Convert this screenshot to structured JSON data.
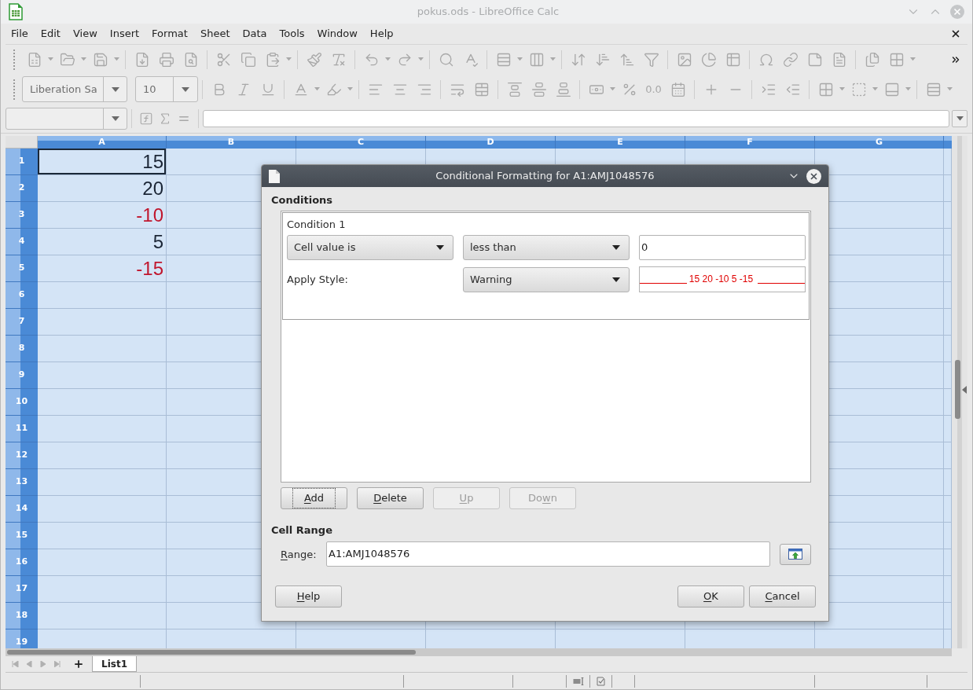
{
  "window": {
    "title": "pokus.ods - LibreOffice Calc"
  },
  "menu_bar": {
    "items": [
      "File",
      "Edit",
      "View",
      "Insert",
      "Format",
      "Sheet",
      "Data",
      "Tools",
      "Window",
      "Help"
    ]
  },
  "toolbars": {
    "disabled": true,
    "font_name": "Liberation Sa",
    "font_size": "10",
    "number_format": "0.0"
  },
  "sheet": {
    "selected": true,
    "columns": [
      "A",
      "B",
      "C",
      "D",
      "E",
      "F",
      "G"
    ],
    "rows": [
      {
        "number": "1",
        "value": "15",
        "warning": false,
        "active": true
      },
      {
        "number": "2",
        "value": "20",
        "warning": false,
        "active": false
      },
      {
        "number": "3",
        "value": "-10",
        "warning": true,
        "active": false
      },
      {
        "number": "4",
        "value": "5",
        "warning": false,
        "active": false
      },
      {
        "number": "5",
        "value": "-15",
        "warning": true,
        "active": false
      },
      {
        "number": "6"
      },
      {
        "number": "7"
      },
      {
        "number": "8"
      },
      {
        "number": "9"
      },
      {
        "number": "10"
      },
      {
        "number": "11"
      },
      {
        "number": "12"
      },
      {
        "number": "13"
      },
      {
        "number": "14"
      },
      {
        "number": "15"
      },
      {
        "number": "16"
      },
      {
        "number": "17"
      },
      {
        "number": "18"
      },
      {
        "number": "19"
      }
    ]
  },
  "sheet_tabs": [
    {
      "label": "List1",
      "selected": true
    }
  ],
  "dialog": {
    "title": "Conditional Formatting for A1:AMJ1048576",
    "conditions_heading": "Conditions",
    "conditions": [
      {
        "label": "Condition 1",
        "type": "Cell value is",
        "operator": "less than",
        "value": "0",
        "style_label": "Apply Style:",
        "style": "Warning",
        "preview": "15 20 -10 5 -15"
      }
    ],
    "list_buttons": [
      {
        "label": [
          {
            "text": "A",
            "underlined": true
          },
          {
            "text": "dd",
            "underlined": false
          }
        ],
        "disabled": false,
        "focused": true
      },
      {
        "label": [
          {
            "text": "D",
            "underlined": true
          },
          {
            "text": "elete",
            "underlined": false
          }
        ],
        "disabled": false,
        "focused": false
      },
      {
        "label": [
          {
            "text": "U",
            "underlined": true
          },
          {
            "text": "p",
            "underlined": false
          }
        ],
        "disabled": true,
        "focused": false
      },
      {
        "label": [
          {
            "text": "Do",
            "underlined": false
          },
          {
            "text": "w",
            "underlined": true
          },
          {
            "text": "n",
            "underlined": false
          }
        ],
        "disabled": true,
        "focused": false
      }
    ],
    "cell_range": {
      "heading": "Cell Range",
      "label": [
        {
          "text": "R",
          "underlined": true
        },
        {
          "text": "ange:",
          "underlined": false
        }
      ],
      "value": "A1:AMJ1048576"
    },
    "footer_buttons": [
      {
        "label": [
          {
            "text": "H",
            "underlined": true
          },
          {
            "text": "elp",
            "underlined": false
          }
        ],
        "kind": "help"
      },
      {
        "label": [
          {
            "text": "O",
            "underlined": true
          },
          {
            "text": "K",
            "underlined": false
          }
        ],
        "kind": "ok"
      },
      {
        "label": [
          {
            "text": "C",
            "underlined": true
          },
          {
            "text": "ancel",
            "underlined": false
          }
        ],
        "kind": "cancel"
      }
    ]
  }
}
